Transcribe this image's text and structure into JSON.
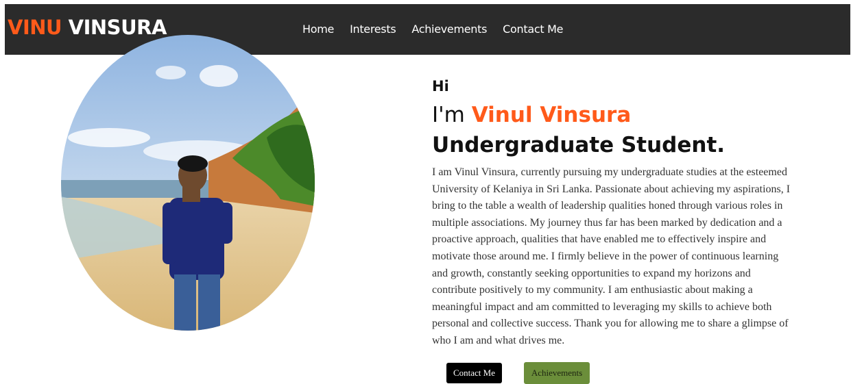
{
  "header": {
    "logo_first": "VINU",
    "logo_second": "VINSURA",
    "nav": [
      "Home",
      "Interests",
      "Achievements",
      "Contact Me"
    ]
  },
  "hero": {
    "greeting": "Hi",
    "intro_prefix": "I'm",
    "name": "Vinul Vinsura",
    "role": "Undergraduate Student.",
    "bio": "I am Vinul Vinsura, currently pursuing my undergraduate studies at the esteemed University of Kelaniya in Sri Lanka. Passionate about achieving my aspirations, I bring to the table a wealth of leadership qualities honed through various roles in multiple associations. My journey thus far has been marked by dedication and a proactive approach, qualities that have enabled me to effectively inspire and motivate those around me. I firmly believe in the power of continuous learning and growth, constantly seeking opportunities to expand my horizons and contribute positively to my community. I am enthusiastic about making a meaningful impact and am committed to leveraging my skills to achieve both personal and collective success. Thank you for allowing me to share a glimpse of who I am and what drives me.",
    "buttons": {
      "contact": "Contact Me",
      "achievements": "Achievements"
    }
  },
  "colors": {
    "accent": "#ff5a1a",
    "header_bg": "#2b2b2b",
    "achievements_button": "#6b8e3a"
  }
}
